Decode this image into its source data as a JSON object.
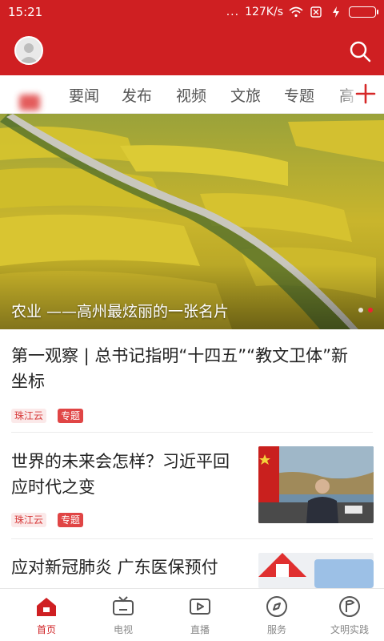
{
  "status_bar": {
    "time": "15:21",
    "dots": "...",
    "speed": "127K/s"
  },
  "header": {
    "title": "",
    "avatar_icon": "user-avatar-icon",
    "search_icon": "search-icon"
  },
  "channels": {
    "tabs": [
      {
        "label": "要闻"
      },
      {
        "label": "发布"
      },
      {
        "label": "视频"
      },
      {
        "label": "文旅"
      },
      {
        "label": "专题"
      },
      {
        "label": "高"
      }
    ],
    "add_icon": "plus-icon"
  },
  "banner": {
    "caption": "农业 ——高州最炫丽的一张名片"
  },
  "news": [
    {
      "title_line1": "第一观察 | 总书记指明“十四五”“教文卫体”新",
      "title_line2": "坐标",
      "source": "珠江云",
      "tag": "专题"
    },
    {
      "title_line1": "世界的未来会怎样？习近平回",
      "title_line2": "应时代之变",
      "source": "珠江云",
      "tag": "专题"
    },
    {
      "title_line1": "应对新冠肺炎 广东医保预付",
      "title_line2": ""
    }
  ],
  "bottom_nav": [
    {
      "label": "首页",
      "icon": "home-icon"
    },
    {
      "label": "电视",
      "icon": "tv-icon"
    },
    {
      "label": "直播",
      "icon": "live-video-icon"
    },
    {
      "label": "服务",
      "icon": "compass-icon"
    },
    {
      "label": "文明实践",
      "icon": "flag-icon"
    }
  ],
  "colors": {
    "brand": "#cf1f22",
    "tag_bg": "#fbe9e9"
  }
}
